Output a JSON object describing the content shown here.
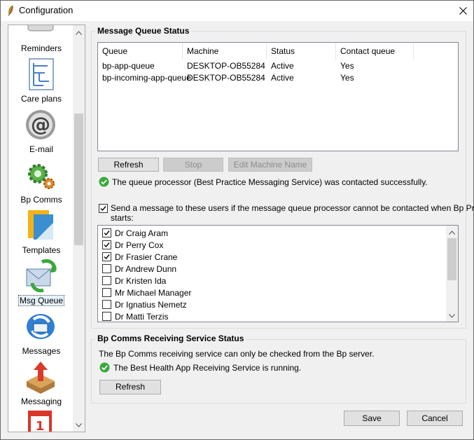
{
  "window": {
    "title": "Configuration"
  },
  "sidebar": {
    "items": [
      {
        "label": "Reminders",
        "icon": "reminders-icon"
      },
      {
        "label": "Care plans",
        "icon": "care-plans-icon"
      },
      {
        "label": "E-mail",
        "icon": "email-icon"
      },
      {
        "label": "Bp Comms",
        "icon": "bp-comms-icon"
      },
      {
        "label": "Templates",
        "icon": "templates-icon"
      },
      {
        "label": "Msg Queue",
        "icon": "msg-queue-icon",
        "selected": true
      },
      {
        "label": "Messages",
        "icon": "messages-icon"
      },
      {
        "label": "Messaging",
        "icon": "messaging-icon"
      }
    ]
  },
  "queue_status": {
    "title": "Message Queue Status",
    "columns": [
      "Queue",
      "Machine",
      "Status",
      "Contact queue"
    ],
    "rows": [
      [
        "bp-app-queue",
        "DESKTOP-OB55284",
        "Active",
        "Yes"
      ],
      [
        "bp-incoming-app-queue",
        "DESKTOP-OB55284",
        "Active",
        "Yes"
      ]
    ],
    "buttons": {
      "refresh": "Refresh",
      "stop": "Stop",
      "edit_machine_name": "Edit Machine Name"
    },
    "status_message": "The queue processor (Best Practice Messaging Service) was contacted successfully.",
    "notify_checkbox": {
      "checked": true,
      "label_line1": "Send a message to these users if the message queue processor cannot be contacted when Bp Premier",
      "label_line2": "starts:"
    },
    "users": [
      {
        "name": "Dr Craig Aram",
        "checked": true
      },
      {
        "name": "Dr Perry Cox",
        "checked": true
      },
      {
        "name": "Dr Frasier Crane",
        "checked": true
      },
      {
        "name": "Dr Andrew Dunn",
        "checked": false
      },
      {
        "name": "Dr Kristen Ida",
        "checked": false
      },
      {
        "name": "Mr Michael Manager",
        "checked": false
      },
      {
        "name": "Dr Ignatius Nemetz",
        "checked": false
      },
      {
        "name": "Dr Matti Terzis",
        "checked": false
      }
    ]
  },
  "receiving_status": {
    "title": "Bp Comms Receiving Service Status",
    "info": "The Bp Comms receiving service can only be checked from the Bp server.",
    "status_message": "The Best Health App Receiving Service is running.",
    "refresh_label": "Refresh"
  },
  "footer": {
    "save_label": "Save",
    "cancel_label": "Cancel"
  },
  "colors": {
    "ok_green": "#3aa83a",
    "selection": "#e5f1fb"
  }
}
